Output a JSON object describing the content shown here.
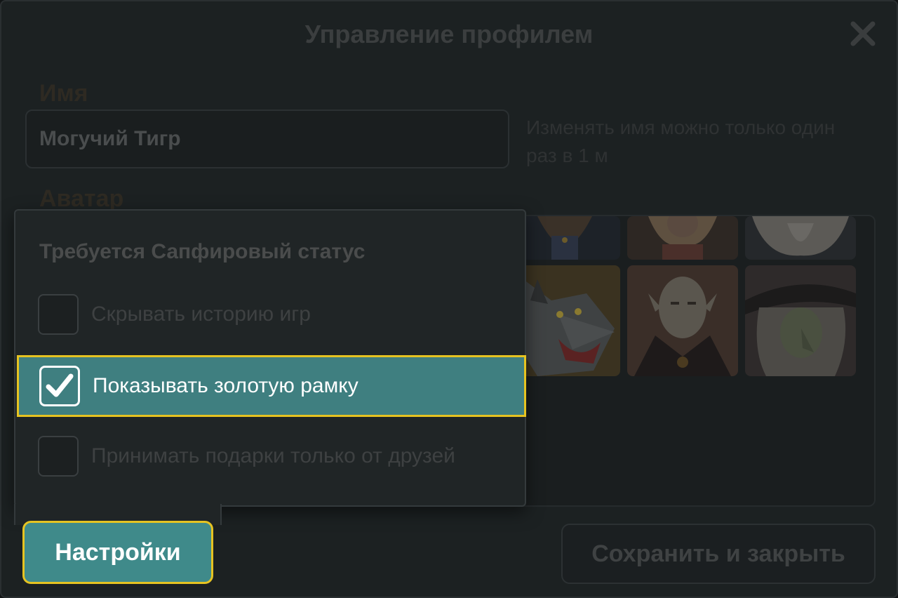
{
  "dialog": {
    "title": "Управление профилем"
  },
  "name_section": {
    "label": "Имя",
    "value": "Могучий Тигр",
    "hint": "Изменять имя можно только один раз в 1 м"
  },
  "avatar_section": {
    "label": "Аватар",
    "avatars": [
      "avatar-woman-dark",
      "avatar-woman-blonde",
      "avatar-old-wizard",
      "avatar-werewolf",
      "avatar-vampire",
      "avatar-witch"
    ]
  },
  "popup": {
    "heading": "Требуется Сапфировый статус",
    "options": [
      {
        "label": "Скрывать историю игр",
        "checked": false
      },
      {
        "label": "Показывать золотую рамку",
        "checked": true
      },
      {
        "label": "Принимать подарки только от друзей",
        "checked": false
      }
    ]
  },
  "footer": {
    "settings_label": "Настройки",
    "save_label": "Сохранить и закрыть"
  },
  "colors": {
    "accent_teal": "#3f8a8a",
    "highlight_yellow": "#e6c321"
  }
}
